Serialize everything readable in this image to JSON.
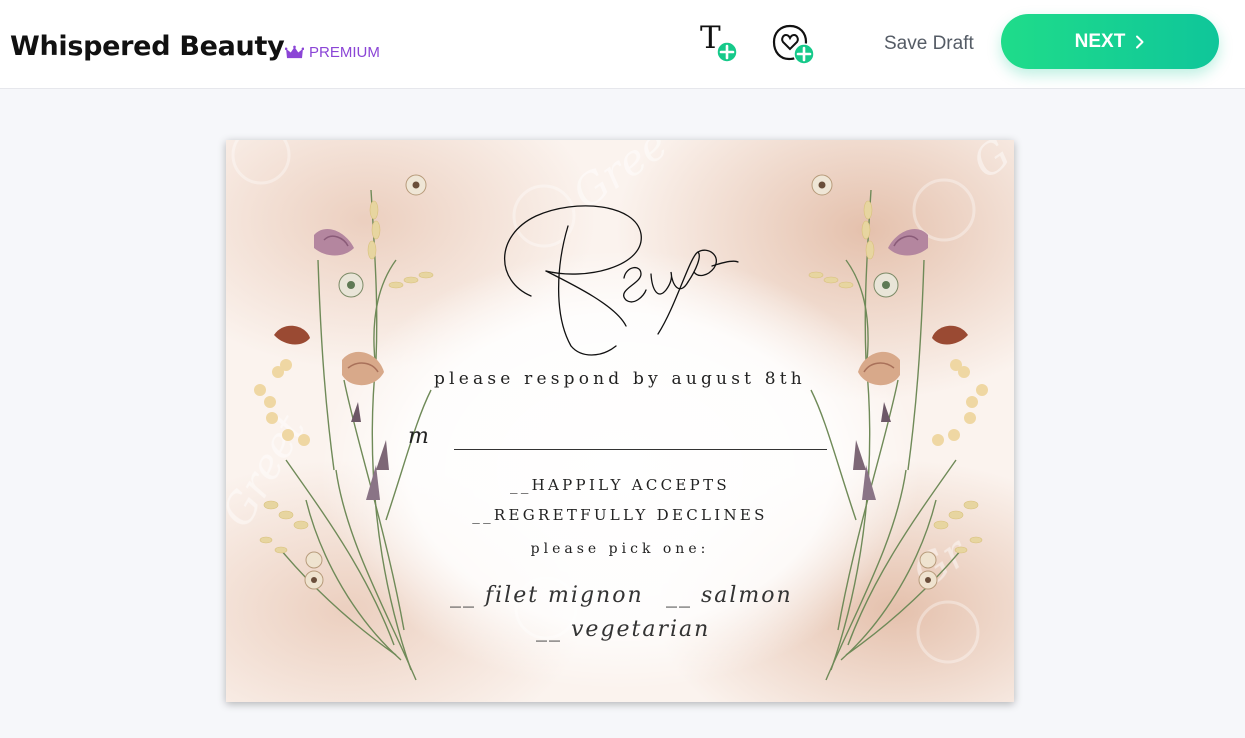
{
  "header": {
    "title": "Whispered Beauty",
    "badge": "PREMIUM",
    "save_label": "Save Draft",
    "next_label": "NEXT"
  },
  "icons": {
    "add_text": "text-add-icon",
    "add_sticker": "sticker-add-icon",
    "crown": "crown-icon",
    "next_chevron": "chevron-right-icon"
  },
  "card": {
    "script_title": "Rsvp",
    "respond_line": "please respond by august 8th",
    "name_prefix": "m",
    "accept": "__HAPPILY ACCEPTS",
    "decline": "__REGRETFULLY DECLINES",
    "pick_prompt": "please pick one:",
    "options": [
      "__ filet mignon",
      "__ salmon",
      "__ vegetarian"
    ],
    "watermark": "Greetings Island"
  },
  "colors": {
    "premium": "#8b45d6",
    "next_button": "#14d18f",
    "plus_badge": "#16c98a",
    "blush": "#e7c6b3"
  }
}
